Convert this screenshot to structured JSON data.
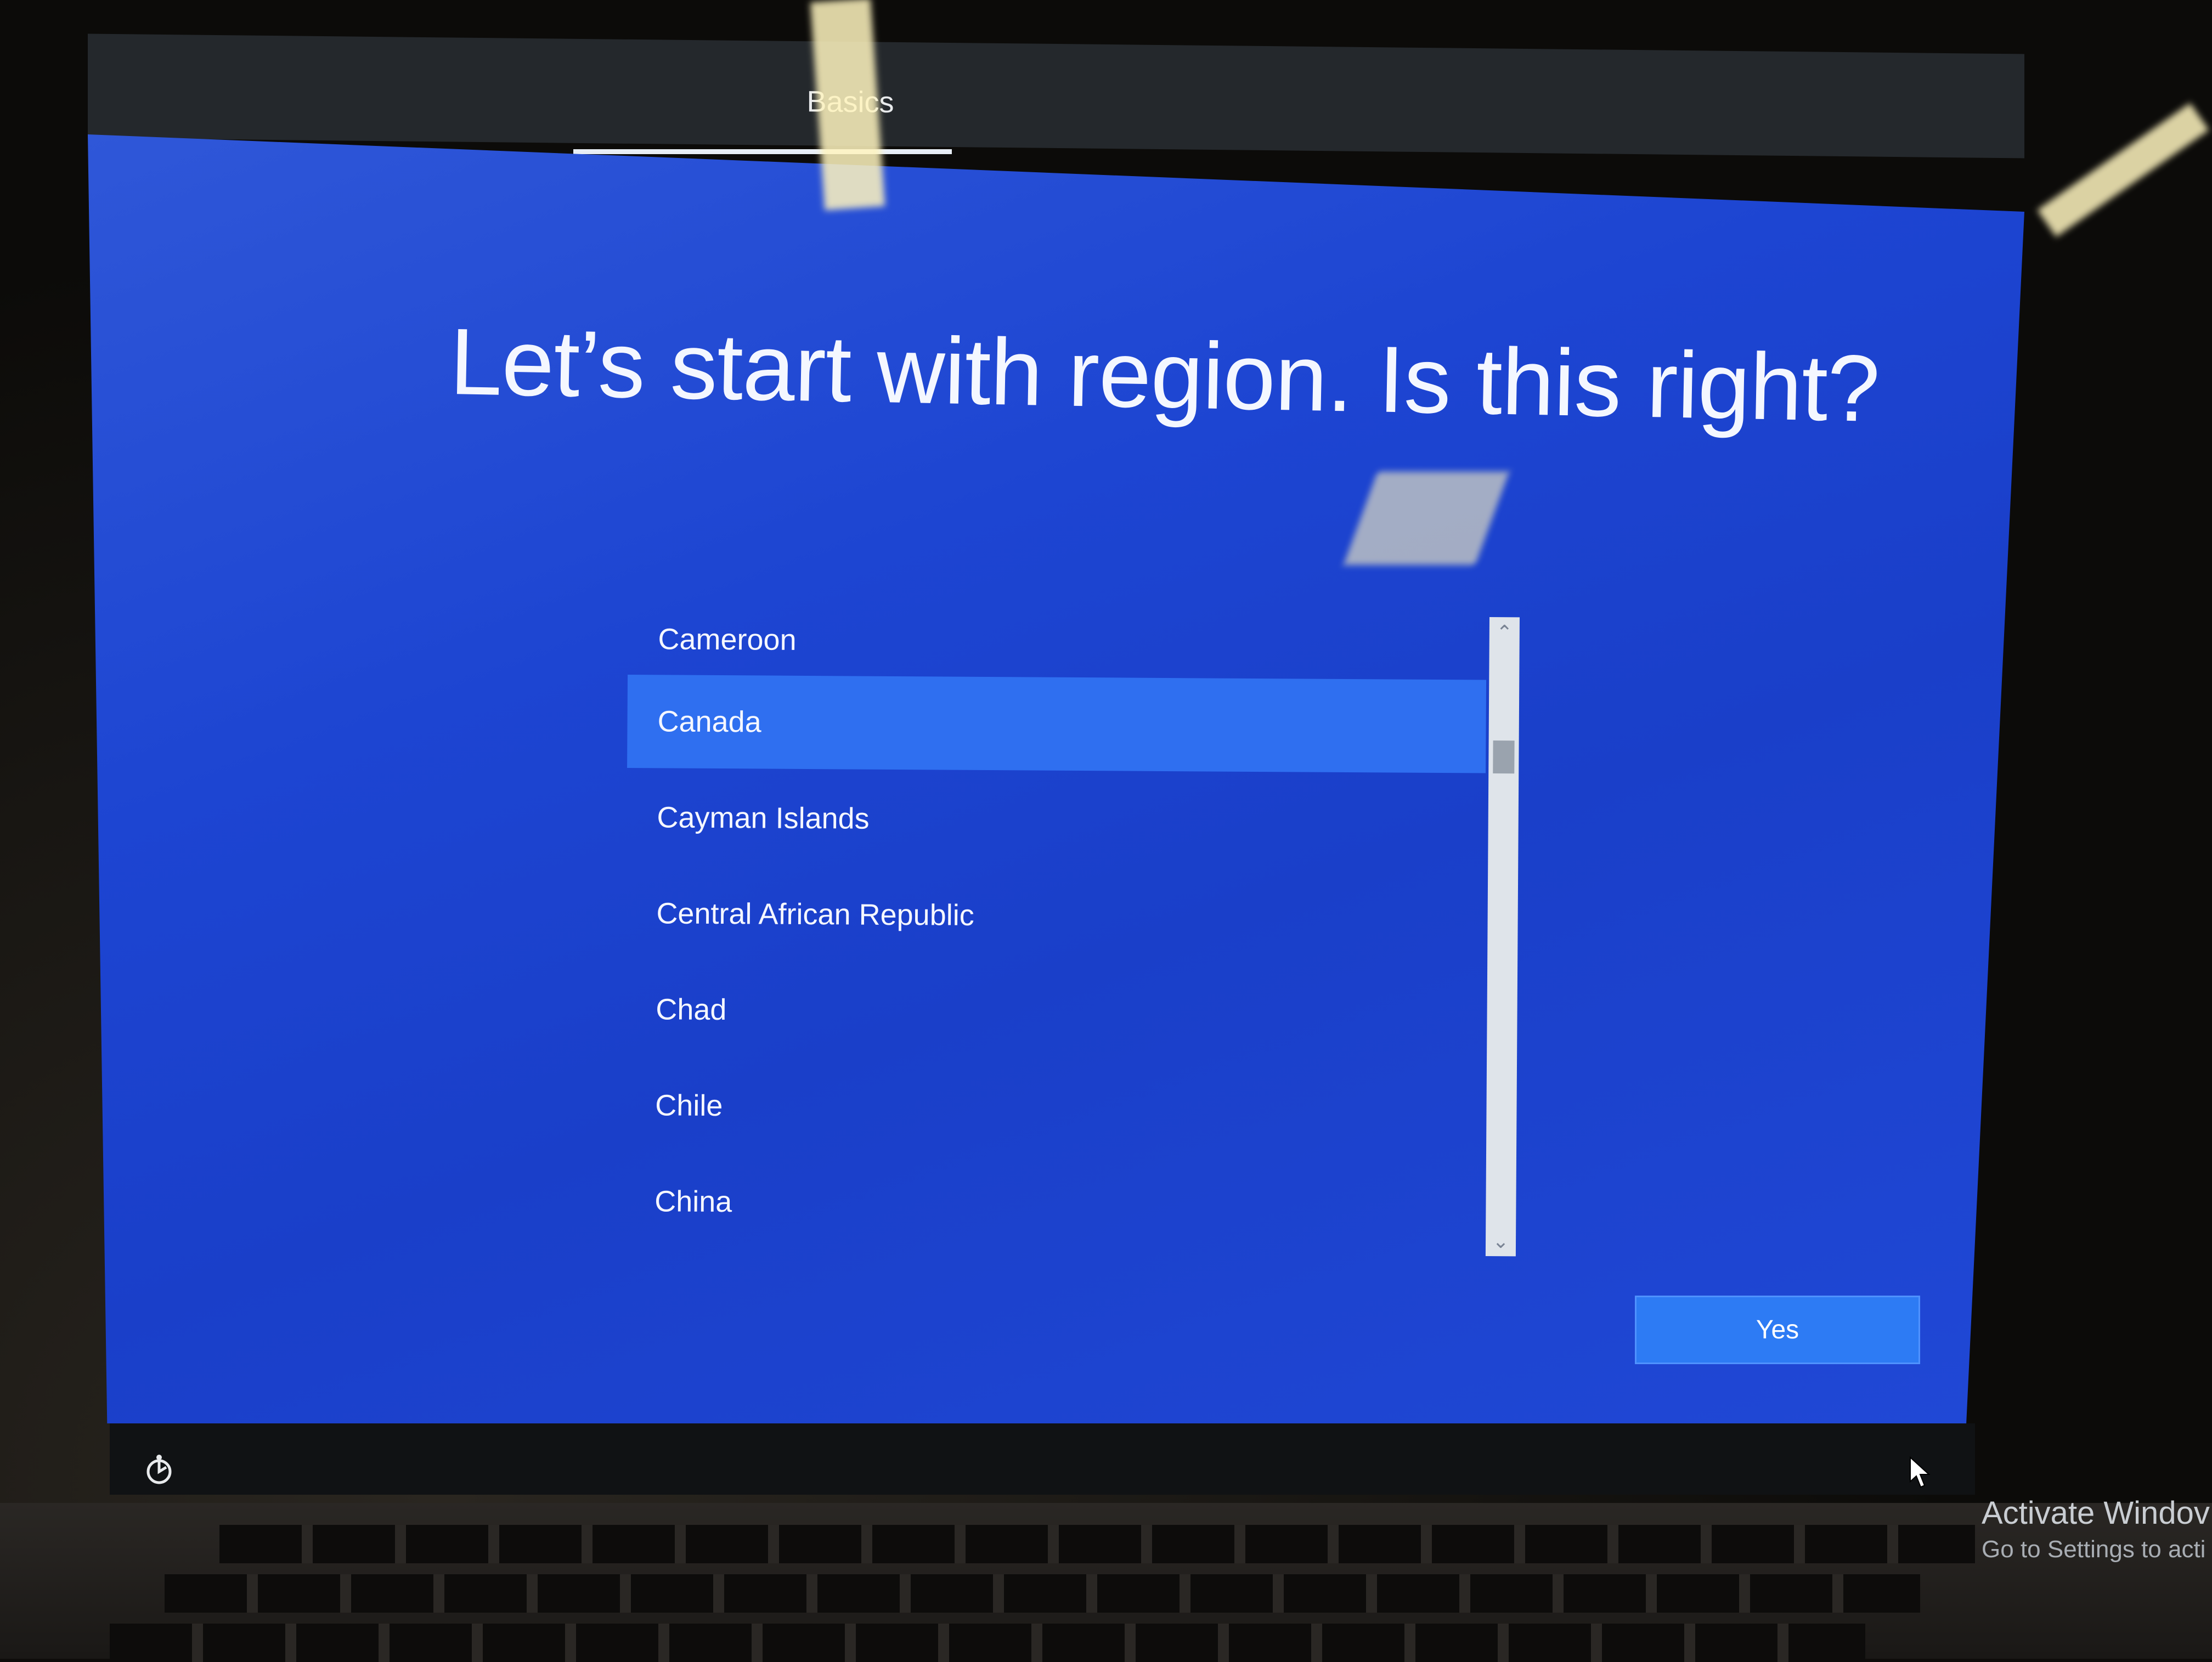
{
  "header": {
    "tab_label": "Basics"
  },
  "main": {
    "title": "Let’s start with region. Is this right?",
    "regions": [
      {
        "label": "Cameroon",
        "selected": false
      },
      {
        "label": "Canada",
        "selected": true
      },
      {
        "label": "Cayman Islands",
        "selected": false
      },
      {
        "label": "Central African Republic",
        "selected": false
      },
      {
        "label": "Chad",
        "selected": false
      },
      {
        "label": "Chile",
        "selected": false
      },
      {
        "label": "China",
        "selected": false
      }
    ],
    "confirm_label": "Yes"
  },
  "scrollbar": {
    "up_icon": "chevron-up-icon",
    "down_icon": "chevron-down-icon"
  },
  "bottom_bar": {
    "accessibility_icon": "accessibility-icon"
  },
  "watermark": {
    "title": "Activate Windov",
    "subtitle": "Go to Settings to acti"
  },
  "colors": {
    "panel_blue": "#1d45d2",
    "selected_row": "#2f6ff0",
    "button": "#2d7bf4",
    "top_bar": "#24282c"
  }
}
